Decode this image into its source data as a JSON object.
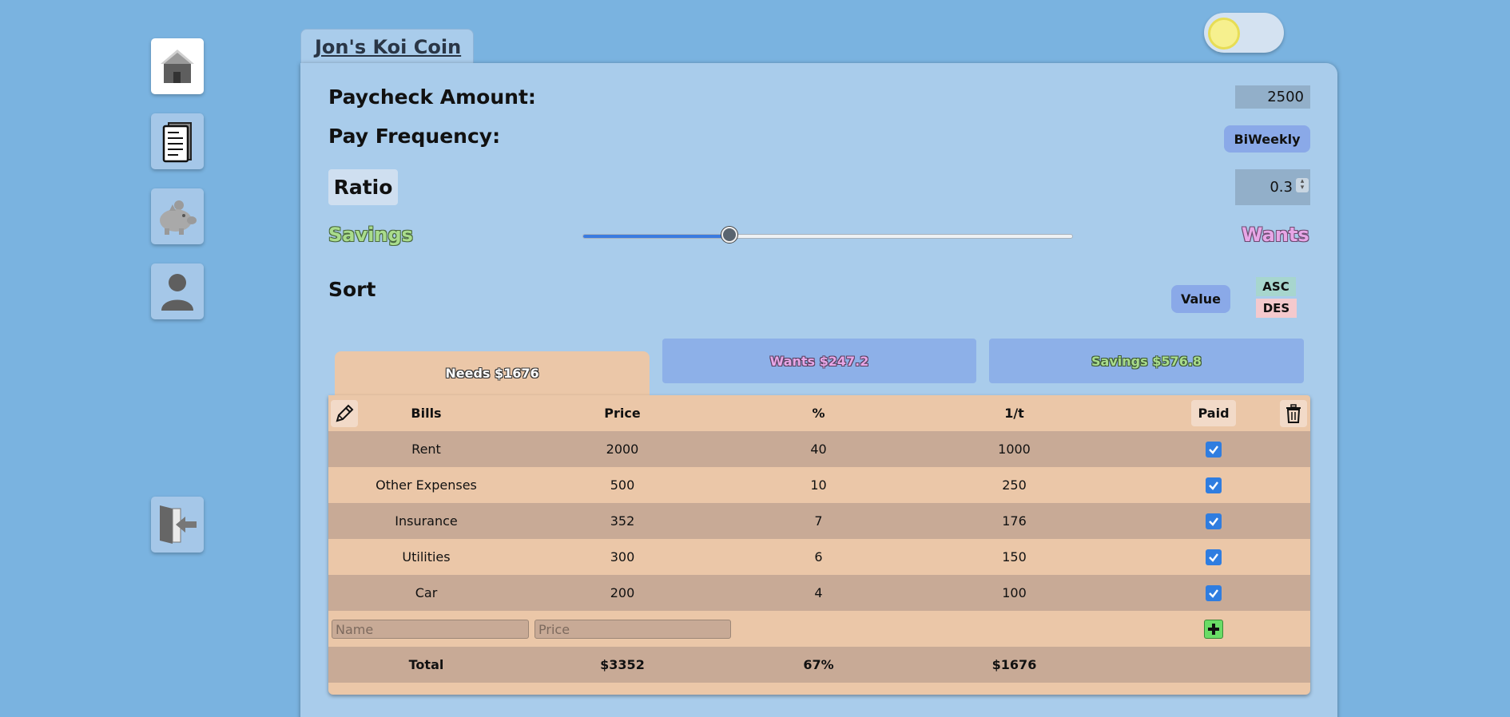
{
  "app": {
    "title": "Jon's Koi Coin"
  },
  "nav": {
    "items": [
      {
        "icon": "home-icon"
      },
      {
        "icon": "document-icon"
      },
      {
        "icon": "piggy-bank-icon"
      },
      {
        "icon": "user-icon"
      },
      {
        "icon": "logout-icon"
      }
    ]
  },
  "form": {
    "paycheck_label": "Paycheck Amount:",
    "paycheck_value": "2500",
    "frequency_label": "Pay Frequency:",
    "frequency_value": "BiWeekly",
    "ratio_label": "Ratio",
    "ratio_value": "0.3",
    "slider_left_label": "Savings",
    "slider_right_label": "Wants",
    "slider_value": 0.3,
    "sort_label": "Sort",
    "sort_value": "Value",
    "sort_asc": "ASC",
    "sort_des": "DES"
  },
  "tabs": {
    "needs": "Needs $1676",
    "wants": "Wants $247.2",
    "savings": "Savings $576.8"
  },
  "table": {
    "headers": {
      "bills": "Bills",
      "price": "Price",
      "percent": "%",
      "per": "1/t",
      "paid": "Paid"
    },
    "rows": [
      {
        "bill": "Rent",
        "price": "2000",
        "percent": "40",
        "per": "1000",
        "paid": true
      },
      {
        "bill": "Other Expenses",
        "price": "500",
        "percent": "10",
        "per": "250",
        "paid": true
      },
      {
        "bill": "Insurance",
        "price": "352",
        "percent": "7",
        "per": "176",
        "paid": true
      },
      {
        "bill": "Utilities",
        "price": "300",
        "percent": "6",
        "per": "150",
        "paid": true
      },
      {
        "bill": "Car",
        "price": "200",
        "percent": "4",
        "per": "100",
        "paid": true
      }
    ],
    "new_row": {
      "name_placeholder": "Name",
      "price_placeholder": "Price"
    },
    "total": {
      "label": "Total",
      "price": "$3352",
      "percent": "67%",
      "per": "$1676"
    }
  },
  "colors": {
    "background": "#7ab3e0",
    "panel": "#a9cceb",
    "needs": "#ebc7a8",
    "tab_inactive": "#8db0e8",
    "check": "#2f7de0",
    "add": "#6adc66"
  }
}
